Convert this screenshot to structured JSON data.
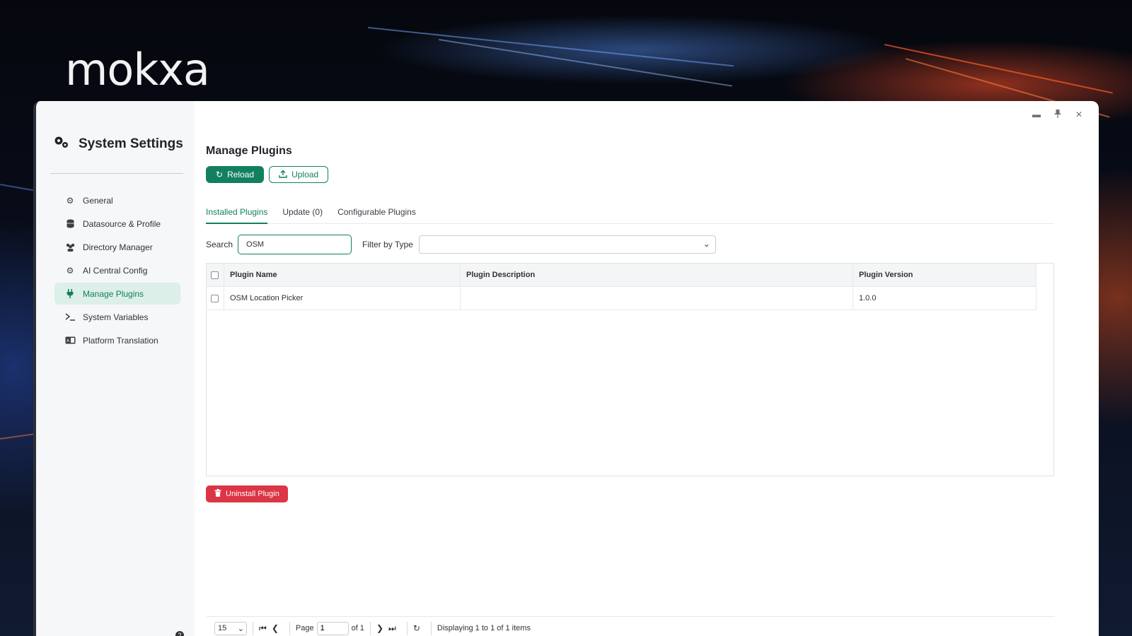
{
  "brand": {
    "logo_text": "mokxa"
  },
  "sidebar": {
    "title": "System Settings",
    "items": [
      {
        "label": "General",
        "icon": "gear-icon",
        "active": false
      },
      {
        "label": "Datasource & Profile",
        "icon": "database-icon",
        "active": false
      },
      {
        "label": "Directory Manager",
        "icon": "users-icon",
        "active": false
      },
      {
        "label": "AI Central Config",
        "icon": "gear-icon",
        "active": false
      },
      {
        "label": "Manage Plugins",
        "icon": "plug-icon",
        "active": true
      },
      {
        "label": "System Variables",
        "icon": "terminal-icon",
        "active": false
      },
      {
        "label": "Platform Translation",
        "icon": "language-icon",
        "active": false
      }
    ]
  },
  "window_controls": [
    "minimize-icon",
    "pin-icon",
    "close-icon"
  ],
  "main": {
    "title": "Manage Plugins",
    "buttons": {
      "reload": "Reload",
      "upload": "Upload"
    },
    "tabs": [
      {
        "label": "Installed Plugins",
        "active": true
      },
      {
        "label": "Update (0)",
        "active": false
      },
      {
        "label": "Configurable Plugins",
        "active": false
      }
    ],
    "filters": {
      "search_label": "Search",
      "search_value": "OSM",
      "type_label": "Filter by Type",
      "type_value": ""
    },
    "table": {
      "columns": [
        "Plugin Name",
        "Plugin Description",
        "Plugin Version"
      ],
      "rows": [
        {
          "name": "OSM Location Picker",
          "description": "",
          "version": "1.0.0"
        }
      ]
    },
    "pager": {
      "page_size": "15",
      "page_label": "Page",
      "page_value": "1",
      "of_label": "of 1",
      "display_text": "Displaying 1 to 1 of 1 items"
    },
    "uninstall_label": "Uninstall Plugin"
  },
  "colors": {
    "accent": "#12805f",
    "danger": "#dc3545",
    "active_bg": "#dcefe8"
  }
}
